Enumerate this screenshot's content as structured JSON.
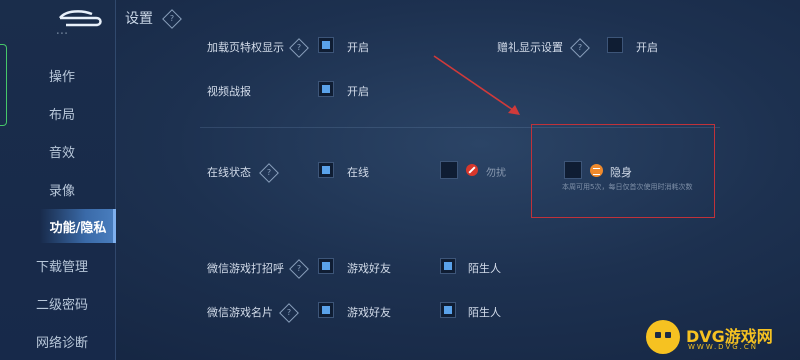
{
  "sidebar": {
    "items": [
      {
        "label": "操作"
      },
      {
        "label": "布局"
      },
      {
        "label": "音效"
      },
      {
        "label": "录像"
      },
      {
        "label": "功能/隐私",
        "active": true
      },
      {
        "label": "下载管理"
      },
      {
        "label": "二级密码"
      },
      {
        "label": "网络诊断"
      }
    ]
  },
  "header": {
    "title": "设置",
    "help_icon": "question-diamond-icon"
  },
  "settings": {
    "loading_privilege": {
      "label": "加载页特权显示",
      "option": "开启",
      "checked": true
    },
    "gift_display": {
      "label": "赠礼显示设置",
      "option": "开启",
      "checked": false
    },
    "video_report": {
      "label": "视频战报",
      "option": "开启",
      "checked": true
    },
    "online_status": {
      "label": "在线状态",
      "options": [
        {
          "label": "在线",
          "checked": true
        },
        {
          "label": "勿扰",
          "checked": false,
          "icon": "ban-icon"
        },
        {
          "label": "隐身",
          "checked": false,
          "icon": "hide-icon"
        }
      ],
      "note": "本周可用5次，每日仅首次使用时消耗次数"
    },
    "wechat_greeting": {
      "label": "微信游戏打招呼",
      "options": [
        {
          "label": "游戏好友",
          "checked": true
        },
        {
          "label": "陌生人",
          "checked": true
        }
      ]
    },
    "wechat_card": {
      "label": "微信游戏名片",
      "options": [
        {
          "label": "游戏好友",
          "checked": true
        },
        {
          "label": "陌生人",
          "checked": true
        }
      ]
    }
  },
  "annotation": {
    "box_color": "#c0323a"
  },
  "watermark": {
    "text": "DVG游戏网",
    "sub": "WWW.DVG.CN"
  },
  "colors": {
    "accent": "#5aa2ea",
    "active_tab": "#3a6aa8"
  }
}
